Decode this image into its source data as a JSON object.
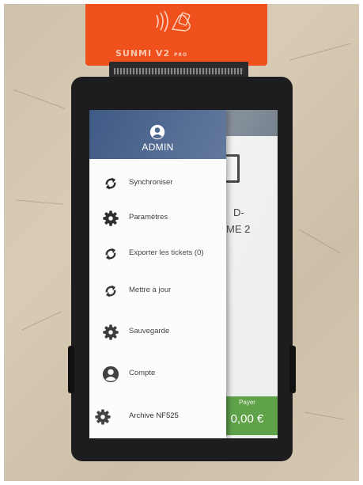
{
  "device": {
    "brand": "SUNMI V2",
    "model_suffix": "PRO",
    "body_color": "#1d1d1f",
    "printer_color": "#f0501c"
  },
  "background_app": {
    "line1": "D-",
    "line2": "ME 2",
    "pay_label": "Payer",
    "pay_amount": "0,00 €",
    "pay_color": "#5fa24a"
  },
  "drawer": {
    "header_color": "#3f5a86",
    "user_icon": "user-icon",
    "user_name": "ADMIN",
    "items": [
      {
        "label": "Synchroniser",
        "icon": "sync-icon"
      },
      {
        "label": "Paramètres",
        "icon": "gear-icon"
      },
      {
        "label": "Exporter les tickets (0)",
        "icon": "sync-icon"
      },
      {
        "label": "Mettre à jour",
        "icon": "sync-icon"
      },
      {
        "label": "Sauvegarde",
        "icon": "gear-icon"
      },
      {
        "label": "Compte",
        "icon": "account-icon"
      },
      {
        "label": "Archive NF525",
        "icon": "gear-icon"
      }
    ]
  }
}
